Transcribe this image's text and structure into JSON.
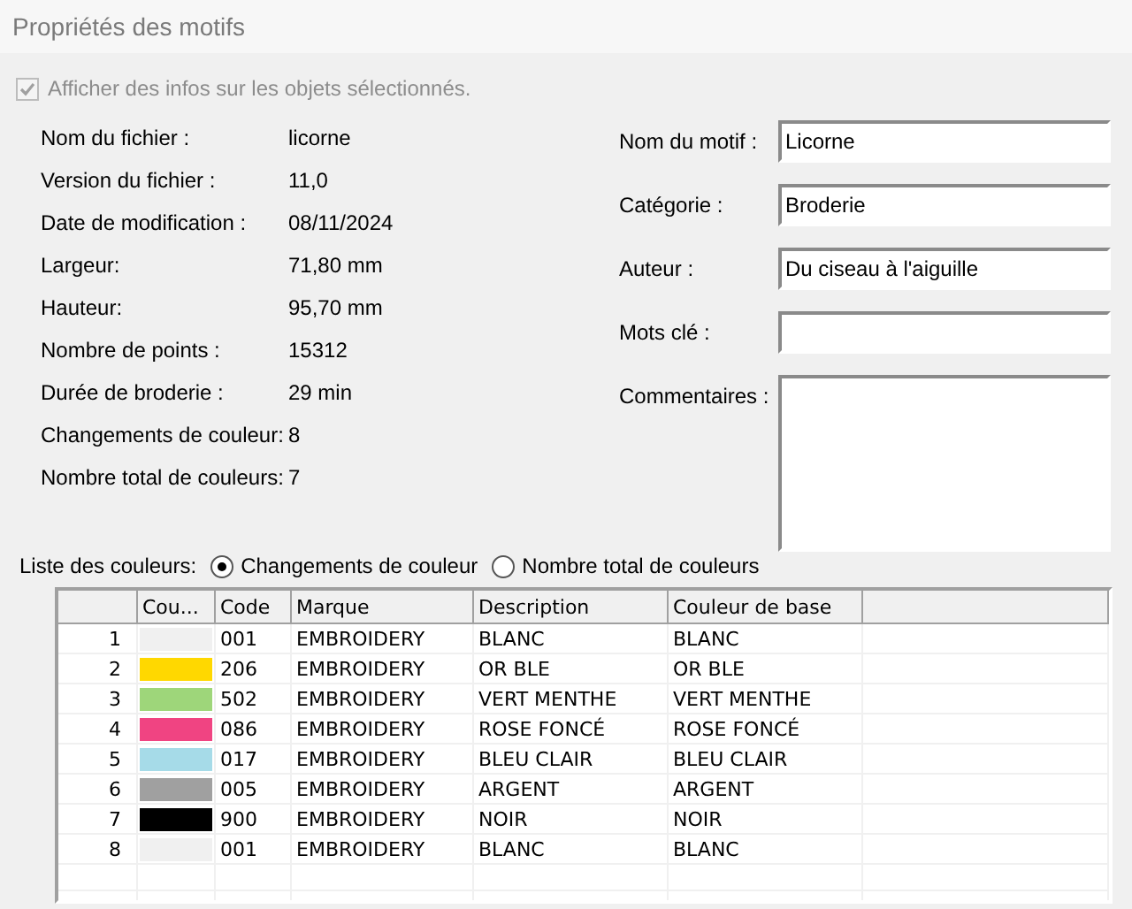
{
  "window": {
    "title": "Propriétés des motifs"
  },
  "show_info": {
    "label": "Afficher des infos sur les objets sélectionnés.",
    "checked": true,
    "disabled": true
  },
  "info": [
    {
      "label": "Nom du fichier :",
      "value": "licorne"
    },
    {
      "label": "Version du fichier :",
      "value": "11,0"
    },
    {
      "label": "Date de modification :",
      "value": "08/11/2024"
    },
    {
      "label": "Largeur:",
      "value": "71,80 mm"
    },
    {
      "label": "Hauteur:",
      "value": "95,70 mm"
    },
    {
      "label": "Nombre de points :",
      "value": "15312"
    },
    {
      "label": "Durée de broderie :",
      "value": "29 min"
    },
    {
      "label": "Changements de couleur:",
      "value": "8"
    },
    {
      "label": "Nombre total de couleurs:",
      "value": "7"
    }
  ],
  "fields": [
    {
      "label": "Nom du motif :",
      "value": "Licorne",
      "kind": "text"
    },
    {
      "label": "Catégorie :",
      "value": "Broderie",
      "kind": "text"
    },
    {
      "label": "Auteur :",
      "value": "Du ciseau à l'aiguille",
      "kind": "text"
    },
    {
      "label": "Mots clé :",
      "kind": "text"
    },
    {
      "label": "Commentaires :",
      "kind": "multiline"
    }
  ],
  "color_list": {
    "label": "Liste des couleurs:",
    "options": [
      {
        "label": "Changements de couleur",
        "selected": true
      },
      {
        "label": "Nombre total de couleurs",
        "selected": false
      }
    ],
    "columns": [
      "Cou...",
      "Code",
      "Marque",
      "Description",
      "Couleur de base"
    ],
    "rows": [
      {
        "number": "1",
        "color": "#f0f0f0",
        "code": "001",
        "brand": "EMBROIDERY",
        "description": "BLANC",
        "base_color": "BLANC"
      },
      {
        "number": "2",
        "color": "#ffd800",
        "code": "206",
        "brand": "EMBROIDERY",
        "description": "OR BLE",
        "base_color": "OR BLE"
      },
      {
        "number": "3",
        "color": "#9ed67a",
        "code": "502",
        "brand": "EMBROIDERY",
        "description": "VERT MENTHE",
        "base_color": "VERT MENTHE"
      },
      {
        "number": "4",
        "color": "#f04482",
        "code": "086",
        "brand": "EMBROIDERY",
        "description": "ROSE FONCÉ",
        "base_color": "ROSE FONCÉ"
      },
      {
        "number": "5",
        "color": "#a6dbe8",
        "code": "017",
        "brand": "EMBROIDERY",
        "description": "BLEU CLAIR",
        "base_color": "BLEU CLAIR"
      },
      {
        "number": "6",
        "color": "#a0a0a0",
        "code": "005",
        "brand": "EMBROIDERY",
        "description": "ARGENT",
        "base_color": "ARGENT"
      },
      {
        "number": "7",
        "color": "#000000",
        "code": "900",
        "brand": "EMBROIDERY",
        "description": "NOIR",
        "base_color": "NOIR"
      },
      {
        "number": "8",
        "color": "#f0f0f0",
        "code": "001",
        "brand": "EMBROIDERY",
        "description": "BLANC",
        "base_color": "BLANC"
      }
    ]
  }
}
